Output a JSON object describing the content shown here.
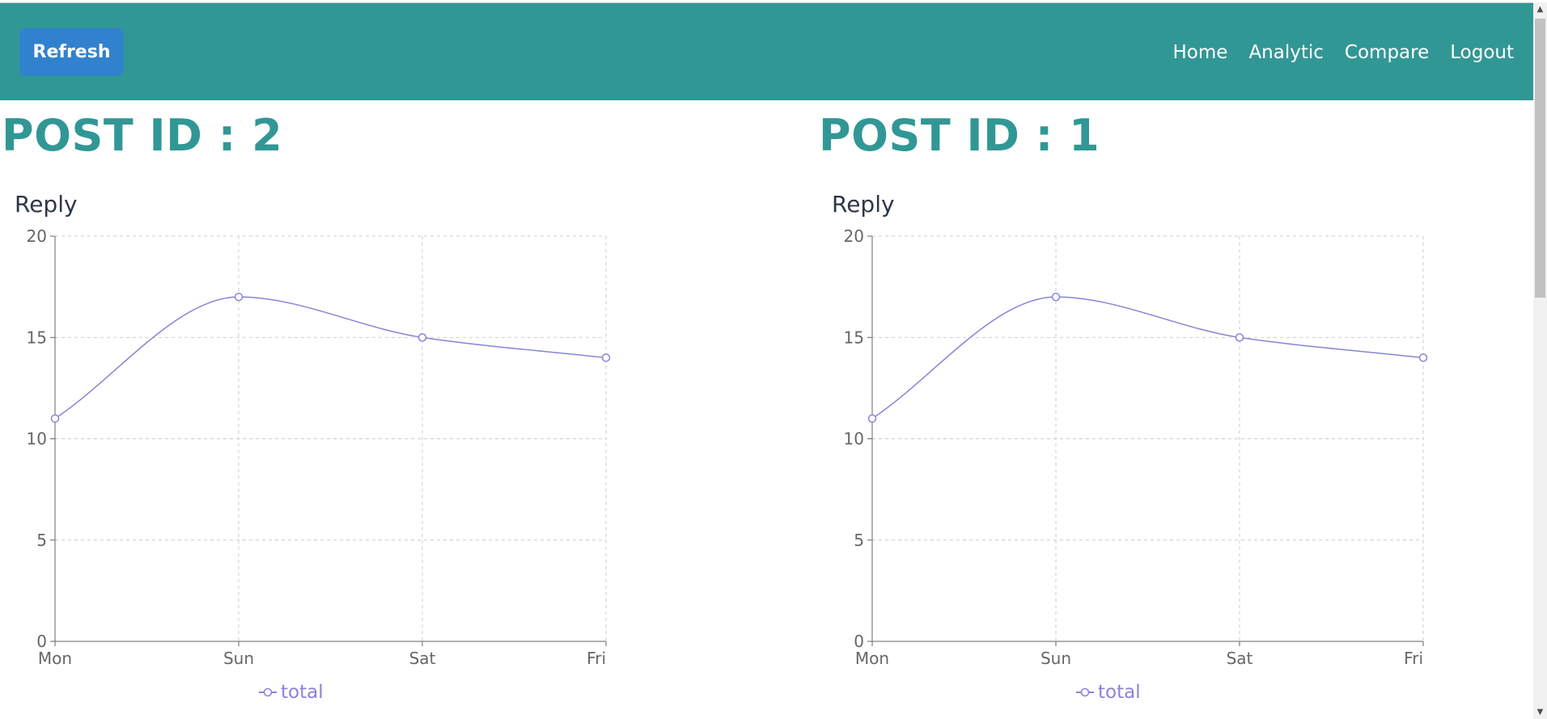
{
  "header": {
    "refresh_label": "Refresh",
    "nav": [
      "Home",
      "Analytic",
      "Compare",
      "Logout"
    ]
  },
  "colors": {
    "header_bg": "#319795",
    "button_bg": "#3182ce",
    "line": "#8884d8"
  },
  "panels": [
    {
      "title": "POST ID : 2",
      "chart_title": "Reply",
      "legend_label": "total"
    },
    {
      "title": "POST ID : 1",
      "chart_title": "Reply",
      "legend_label": "total"
    }
  ],
  "chart_data": [
    {
      "type": "line",
      "title": "Reply",
      "categories": [
        "Mon",
        "Sun",
        "Sat",
        "Fri"
      ],
      "series": [
        {
          "name": "total",
          "values": [
            11,
            17,
            15,
            14
          ]
        }
      ],
      "ylim": [
        0,
        20
      ],
      "yticks": [
        0,
        5,
        10,
        15,
        20
      ],
      "grid": true,
      "legend": "bottom-center"
    },
    {
      "type": "line",
      "title": "Reply",
      "categories": [
        "Mon",
        "Sun",
        "Sat",
        "Fri"
      ],
      "series": [
        {
          "name": "total",
          "values": [
            11,
            17,
            15,
            14
          ]
        }
      ],
      "ylim": [
        0,
        20
      ],
      "yticks": [
        0,
        5,
        10,
        15,
        20
      ],
      "grid": true,
      "legend": "bottom-center"
    }
  ]
}
